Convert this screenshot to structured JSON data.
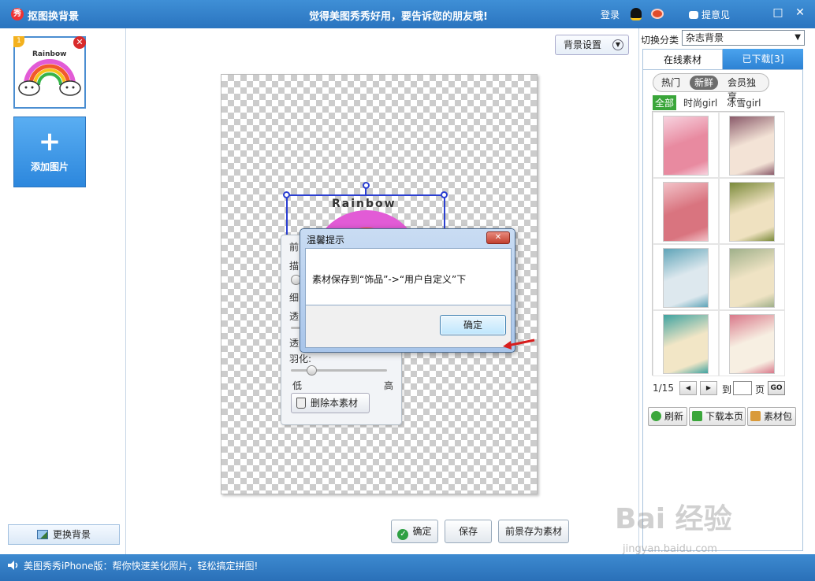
{
  "titlebar": {
    "logo_text": "秀",
    "title": "抠图换背景",
    "slogan": "觉得美图秀秀好用，要告诉您的朋友哦!",
    "login": "登录",
    "feedback": "提意见",
    "maximize": "□",
    "close": "✕"
  },
  "left": {
    "thumb_badge": "1",
    "thumb_close": "✕",
    "thumb_caption": "Rainbow",
    "add_plus": "+",
    "add_label": "添加图片",
    "change_bg": "更换背景"
  },
  "center": {
    "bg_settings": "背景设置",
    "decoration_text": "Rainbow",
    "prop_panel": {
      "row1": "前",
      "row2": "描",
      "row3": "细",
      "row4": "透",
      "row5": "透",
      "feather_label": "羽化:",
      "low": "低",
      "high": "高",
      "delete_label": "删除本素材"
    },
    "dialog": {
      "title": "温馨提示",
      "close": "✕",
      "message": "素材保存到“饰品”->“用户自定义”下",
      "ok": "确定"
    },
    "buttons": {
      "confirm": "确定",
      "save": "保存",
      "save_as_material": "前景存为素材"
    }
  },
  "right": {
    "category_label": "切换分类",
    "category_value": "杂志背景",
    "tabs": [
      "在线素材",
      "已下载[3]"
    ],
    "subtabs": [
      "热门",
      "新鲜",
      "会员独享"
    ],
    "filters": [
      "全部",
      "时尚girl",
      "冰雪girl"
    ],
    "posters": [
      {
        "color": "#e88aa0",
        "accent": "#f7d3df"
      },
      {
        "color": "#f3e3d6",
        "accent": "#8a5a6a"
      },
      {
        "color": "#d9747f",
        "accent": "#f2c2c8"
      },
      {
        "color": "#efe1c0",
        "accent": "#7a8a3a"
      },
      {
        "color": "#dde8ee",
        "accent": "#5fa4b8"
      },
      {
        "color": "#efe3c4",
        "accent": "#9fb08a"
      },
      {
        "color": "#f2e6c6",
        "accent": "#3fa3a0"
      },
      {
        "color": "#f7efe2",
        "accent": "#d9788a"
      }
    ],
    "pager": {
      "current": "1/15",
      "to_label": "到",
      "page_label": "页",
      "go": "GO"
    },
    "actions": {
      "refresh": "刷新",
      "download_page": "下载本页",
      "material_pack": "素材包"
    }
  },
  "status": {
    "text": "美图秀秀iPhone版：帮你快速美化照片，轻松搞定拼图!"
  },
  "watermark": {
    "brand": "Bai 经验",
    "url": "jingyan.baidu.com"
  },
  "colors": {
    "title_bar": "#2a74bf",
    "accent": "#2c87dd",
    "active_filter": "#3aa63a"
  }
}
